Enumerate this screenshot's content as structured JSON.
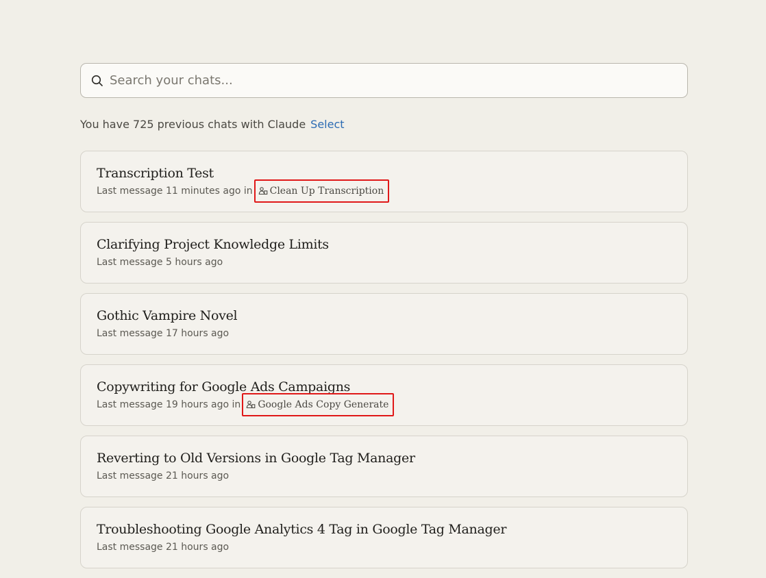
{
  "search": {
    "placeholder": "Search your chats...",
    "icon": "search-icon"
  },
  "summary": {
    "text": "You have 725 previous chats with Claude",
    "select_label": "Select"
  },
  "colors": {
    "background": "#f1efe8",
    "link": "#2b6bb3",
    "highlight": "#e01818"
  },
  "chats": [
    {
      "title": "Transcription Test",
      "meta": "Last message 11 minutes ago in",
      "project": "Clean Up Transcription",
      "project_icon": "project-people-icon"
    },
    {
      "title": "Clarifying Project Knowledge Limits",
      "meta": "Last message 5 hours ago",
      "project": null
    },
    {
      "title": "Gothic Vampire Novel",
      "meta": "Last message 17 hours ago",
      "project": null
    },
    {
      "title": "Copywriting for Google Ads Campaigns",
      "meta": "Last message 19 hours ago in",
      "project": "Google Ads Copy Generate",
      "project_icon": "project-people-icon"
    },
    {
      "title": "Reverting to Old Versions in Google Tag Manager",
      "meta": "Last message 21 hours ago",
      "project": null
    },
    {
      "title": "Troubleshooting Google Analytics 4 Tag in Google Tag Manager",
      "meta": "Last message 21 hours ago",
      "project": null
    }
  ]
}
